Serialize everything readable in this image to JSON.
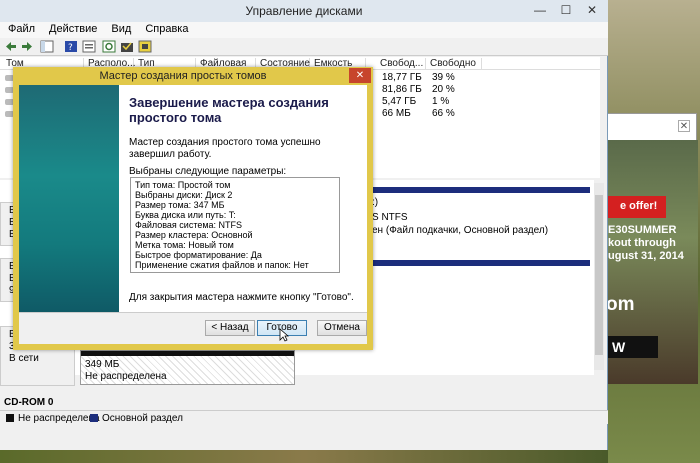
{
  "window": {
    "title": "Управление дисками",
    "minimize": "—",
    "maximize": "☐",
    "close": "✕"
  },
  "menu": [
    "Файл",
    "Действие",
    "Вид",
    "Справка"
  ],
  "volume_list": {
    "headers": [
      "Том",
      "Располо...",
      "Тип",
      "Файловая с...",
      "Состояние",
      "Емкость",
      "Свобод...",
      "Свободно %"
    ],
    "rows": [
      {
        "free": "18,77 ГБ",
        "free_pct": "39 %"
      },
      {
        "free": "81,86 ГБ",
        "free_pct": "20 %"
      },
      {
        "free": "5,47 ГБ",
        "free_pct": "1 %"
      },
      {
        "free": "66 МБ",
        "free_pct": "66 %"
      }
    ]
  },
  "disk_map": {
    "partition_labels": [
      ":)",
      "S NTFS",
      "ен (Файл подкачки, Основной раздел)"
    ],
    "disk_letters": [
      "Б",
      "Б",
      "Б",
      "Б",
      "Б",
      "9",
      "В"
    ],
    "disk2": {
      "size": "349 МБ",
      "status": "В сети"
    },
    "unallocated": {
      "size": "349 МБ",
      "label": "Не распределена"
    }
  },
  "cdrom": "CD-ROM 0",
  "legend": [
    {
      "label": "Не распределена",
      "color": "#111111"
    },
    {
      "label": "Основной раздел",
      "color": "#1c2d7c"
    }
  ],
  "wizard": {
    "title": "Мастер создания простых томов",
    "close": "✕",
    "heading": "Завершение мастера создания простого тома",
    "success": "Мастер создания простого тома успешно завершил работу.",
    "params_label": "Выбраны следующие параметры:",
    "params": [
      "Тип тома: Простой том",
      "Выбраны диски: Диск 2",
      "Размер тома: 347 МБ",
      "Буква диска или путь: T:",
      "Файловая система: NTFS",
      "Размер кластера: Основной",
      "Метка тома: Новый том",
      "Быстрое форматирование: Да",
      "Применение сжатия файлов и папок: Нет"
    ],
    "finish_text": "Для закрытия мастера нажмите кнопку \"Готово\".",
    "buttons": {
      "back": "< Назад",
      "finish": "Готово",
      "cancel": "Отмена"
    }
  },
  "ad": {
    "offer": "e offer!",
    "code_lines": [
      "E30SUMMER",
      "kout through",
      "ugust 31, 2014"
    ],
    "domain": "om",
    "button": "W"
  }
}
